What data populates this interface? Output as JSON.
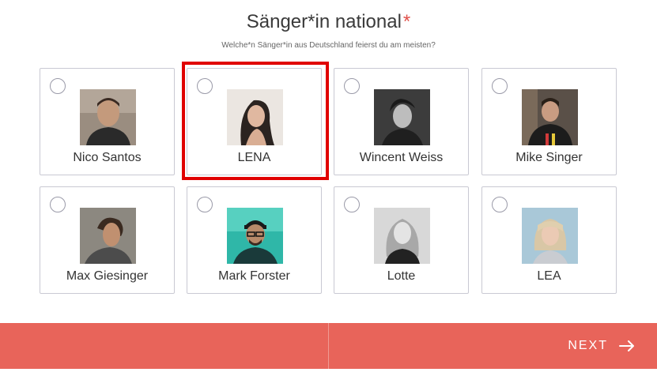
{
  "question": {
    "title": "Sänger*in national",
    "required_mark": "*",
    "subtitle": "Welche*n Sänger*in aus Deutschland feierst du am meisten?"
  },
  "options": [
    {
      "name": "Nico Santos",
      "photo": "portrait-photo",
      "selected": false
    },
    {
      "name": "LENA",
      "photo": "portrait-photo",
      "selected": false
    },
    {
      "name": "Wincent Weiss",
      "photo": "portrait-photo",
      "selected": false
    },
    {
      "name": "Mike Singer",
      "photo": "portrait-photo",
      "selected": false
    },
    {
      "name": "Max Giesinger",
      "photo": "portrait-photo",
      "selected": false
    },
    {
      "name": "Mark Forster",
      "photo": "portrait-photo",
      "selected": false
    },
    {
      "name": "Lotte",
      "photo": "portrait-photo",
      "selected": false
    },
    {
      "name": "LEA",
      "photo": "portrait-photo",
      "selected": false
    }
  ],
  "footer": {
    "next_label": "NEXT",
    "next_icon": "arrow-right-icon"
  },
  "colors": {
    "accent": "#e8645a",
    "required": "#e0504a",
    "highlight": "#e00000",
    "card_border": "#c9c9d3"
  }
}
